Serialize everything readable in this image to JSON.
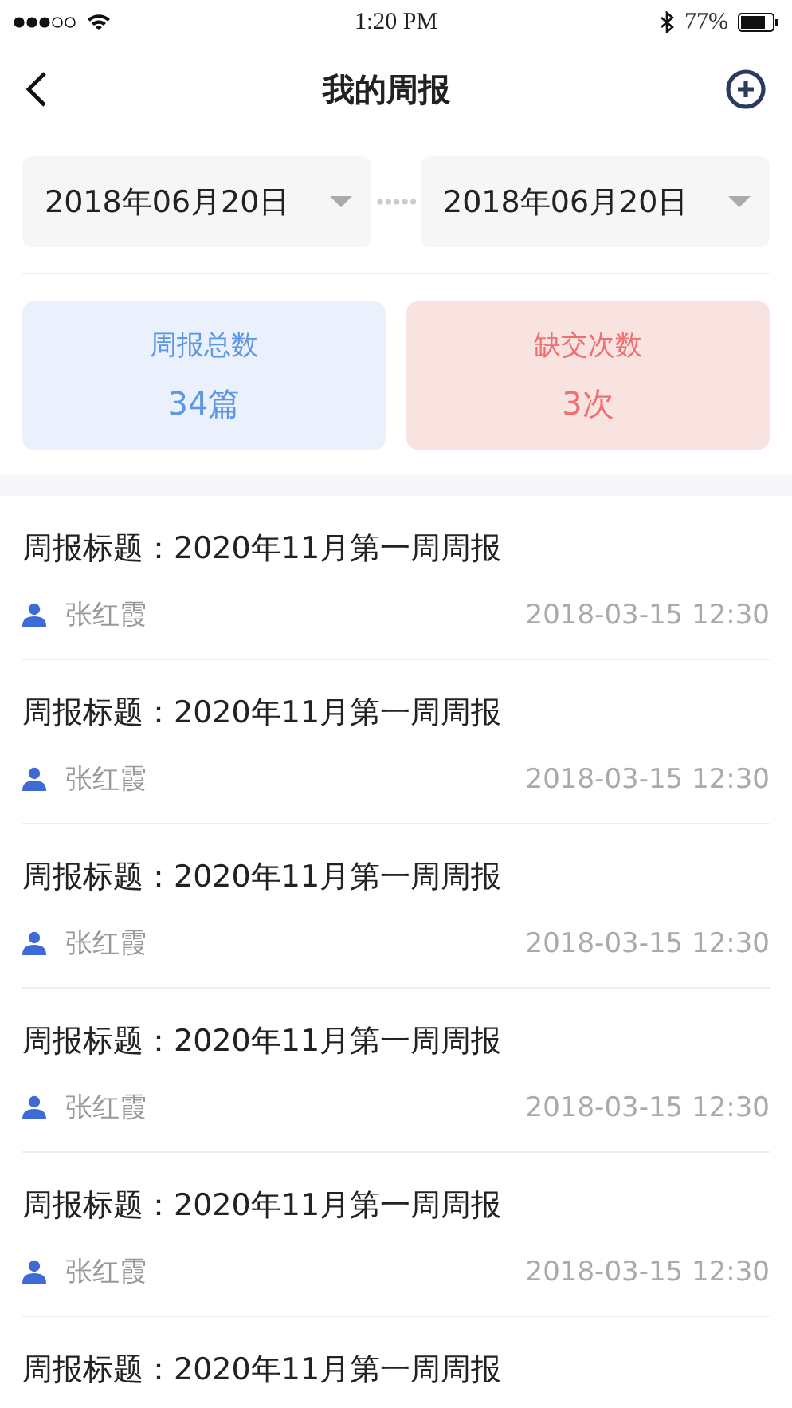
{
  "status_bar": {
    "time": "1:20 PM",
    "battery": "77%"
  },
  "nav": {
    "title": "我的周报"
  },
  "date_range": {
    "start": "2018年06月20日",
    "end": "2018年06月20日"
  },
  "stats": [
    {
      "label": "周报总数",
      "value": "34篇",
      "kind": "total"
    },
    {
      "label": "缺交次数",
      "value": "3次",
      "kind": "missing"
    }
  ],
  "reports": [
    {
      "title": "周报标题：2020年11月第一周周报",
      "author": "张红霞",
      "time": "2018-03-15 12:30"
    },
    {
      "title": "周报标题：2020年11月第一周周报",
      "author": "张红霞",
      "time": "2018-03-15 12:30"
    },
    {
      "title": "周报标题：2020年11月第一周周报",
      "author": "张红霞",
      "time": "2018-03-15 12:30"
    },
    {
      "title": "周报标题：2020年11月第一周周报",
      "author": "张红霞",
      "time": "2018-03-15 12:30"
    },
    {
      "title": "周报标题：2020年11月第一周周报",
      "author": "张红霞",
      "time": "2018-03-15 12:30"
    },
    {
      "title": "周报标题：2020年11月第一周周报"
    }
  ]
}
